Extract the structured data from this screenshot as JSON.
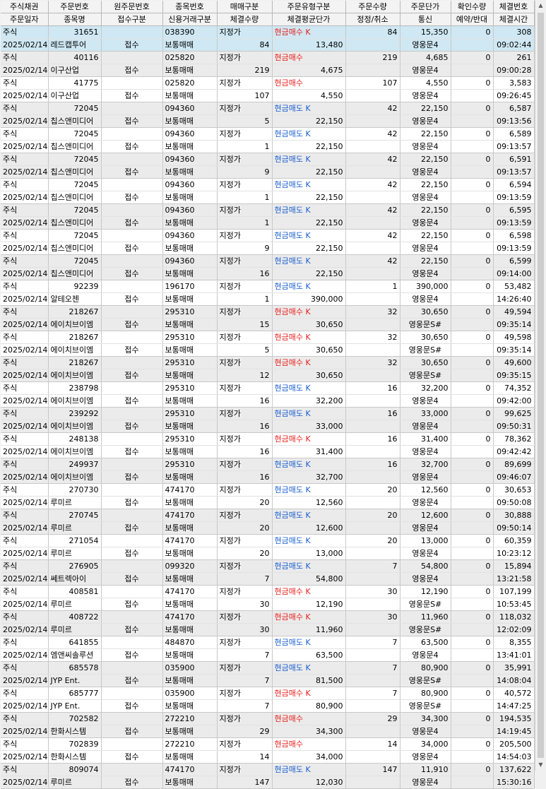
{
  "header": {
    "row1": [
      "주식채권",
      "주문번호",
      "원주문번호",
      "종목번호",
      "매매구분",
      "주문유형구분",
      "주문수량",
      "주문단가",
      "확인수량",
      "체결번호"
    ],
    "row2": [
      "주문일자",
      "종목명",
      "접수구분",
      "신용거래구분",
      "체결수량",
      "체결평균단가",
      "정정/취소",
      "통신",
      "예약/반대",
      "체결시간"
    ]
  },
  "colors": {
    "buy": "#e8201c",
    "sell": "#1a5fd0",
    "selected_row": "#cfe8f3",
    "alt_row": "#ebebeb"
  },
  "rows": [
    {
      "market": "주식",
      "order_no": "31651",
      "orig_order_no": "",
      "stock_code": "038390",
      "trade_type": "지정가",
      "order_type": "현금매수 K",
      "side": "buy",
      "order_qty": "84",
      "order_price": "15,350",
      "confirm_qty": "0",
      "exec_no": "308",
      "date": "2025/02/14",
      "stock_name": "레드캡투어",
      "receipt": "접수",
      "credit_type": "보통매매",
      "exec_qty": "84",
      "avg_price": "13,480",
      "modify_cancel": "",
      "comm": "영웅문4",
      "reserve": "",
      "exec_time": "09:02:44",
      "selected": true
    },
    {
      "market": "주식",
      "order_no": "40116",
      "orig_order_no": "",
      "stock_code": "025820",
      "trade_type": "지정가",
      "order_type": "현금매수",
      "side": "buy",
      "order_qty": "219",
      "order_price": "4,685",
      "confirm_qty": "0",
      "exec_no": "261",
      "date": "2025/02/14",
      "stock_name": "이구산업",
      "receipt": "접수",
      "credit_type": "보통매매",
      "exec_qty": "219",
      "avg_price": "4,675",
      "modify_cancel": "",
      "comm": "영웅문4",
      "reserve": "",
      "exec_time": "09:00:28"
    },
    {
      "market": "주식",
      "order_no": "41775",
      "orig_order_no": "",
      "stock_code": "025820",
      "trade_type": "지정가",
      "order_type": "현금매수",
      "side": "buy",
      "order_qty": "107",
      "order_price": "4,550",
      "confirm_qty": "0",
      "exec_no": "3,583",
      "date": "2025/02/14",
      "stock_name": "이구산업",
      "receipt": "접수",
      "credit_type": "보통매매",
      "exec_qty": "107",
      "avg_price": "4,550",
      "modify_cancel": "",
      "comm": "영웅문4",
      "reserve": "",
      "exec_time": "09:26:45"
    },
    {
      "market": "주식",
      "order_no": "72045",
      "orig_order_no": "",
      "stock_code": "094360",
      "trade_type": "지정가",
      "order_type": "현금매도 K",
      "side": "sell",
      "order_qty": "42",
      "order_price": "22,150",
      "confirm_qty": "0",
      "exec_no": "6,587",
      "date": "2025/02/14",
      "stock_name": "칩스앤미디어",
      "receipt": "접수",
      "credit_type": "보통매매",
      "exec_qty": "5",
      "avg_price": "22,150",
      "modify_cancel": "",
      "comm": "영웅문4",
      "reserve": "",
      "exec_time": "09:13:56"
    },
    {
      "market": "주식",
      "order_no": "72045",
      "orig_order_no": "",
      "stock_code": "094360",
      "trade_type": "지정가",
      "order_type": "현금매도 K",
      "side": "sell",
      "order_qty": "42",
      "order_price": "22,150",
      "confirm_qty": "0",
      "exec_no": "6,589",
      "date": "2025/02/14",
      "stock_name": "칩스앤미디어",
      "receipt": "접수",
      "credit_type": "보통매매",
      "exec_qty": "1",
      "avg_price": "22,150",
      "modify_cancel": "",
      "comm": "영웅문4",
      "reserve": "",
      "exec_time": "09:13:57"
    },
    {
      "market": "주식",
      "order_no": "72045",
      "orig_order_no": "",
      "stock_code": "094360",
      "trade_type": "지정가",
      "order_type": "현금매도 K",
      "side": "sell",
      "order_qty": "42",
      "order_price": "22,150",
      "confirm_qty": "0",
      "exec_no": "6,591",
      "date": "2025/02/14",
      "stock_name": "칩스앤미디어",
      "receipt": "접수",
      "credit_type": "보통매매",
      "exec_qty": "9",
      "avg_price": "22,150",
      "modify_cancel": "",
      "comm": "영웅문4",
      "reserve": "",
      "exec_time": "09:13:57"
    },
    {
      "market": "주식",
      "order_no": "72045",
      "orig_order_no": "",
      "stock_code": "094360",
      "trade_type": "지정가",
      "order_type": "현금매도 K",
      "side": "sell",
      "order_qty": "42",
      "order_price": "22,150",
      "confirm_qty": "0",
      "exec_no": "6,594",
      "date": "2025/02/14",
      "stock_name": "칩스앤미디어",
      "receipt": "접수",
      "credit_type": "보통매매",
      "exec_qty": "1",
      "avg_price": "22,150",
      "modify_cancel": "",
      "comm": "영웅문4",
      "reserve": "",
      "exec_time": "09:13:59"
    },
    {
      "market": "주식",
      "order_no": "72045",
      "orig_order_no": "",
      "stock_code": "094360",
      "trade_type": "지정가",
      "order_type": "현금매도 K",
      "side": "sell",
      "order_qty": "42",
      "order_price": "22,150",
      "confirm_qty": "0",
      "exec_no": "6,595",
      "date": "2025/02/14",
      "stock_name": "칩스앤미디어",
      "receipt": "접수",
      "credit_type": "보통매매",
      "exec_qty": "1",
      "avg_price": "22,150",
      "modify_cancel": "",
      "comm": "영웅문4",
      "reserve": "",
      "exec_time": "09:13:59"
    },
    {
      "market": "주식",
      "order_no": "72045",
      "orig_order_no": "",
      "stock_code": "094360",
      "trade_type": "지정가",
      "order_type": "현금매도 K",
      "side": "sell",
      "order_qty": "42",
      "order_price": "22,150",
      "confirm_qty": "0",
      "exec_no": "6,598",
      "date": "2025/02/14",
      "stock_name": "칩스앤미디어",
      "receipt": "접수",
      "credit_type": "보통매매",
      "exec_qty": "9",
      "avg_price": "22,150",
      "modify_cancel": "",
      "comm": "영웅문4",
      "reserve": "",
      "exec_time": "09:13:59"
    },
    {
      "market": "주식",
      "order_no": "72045",
      "orig_order_no": "",
      "stock_code": "094360",
      "trade_type": "지정가",
      "order_type": "현금매도 K",
      "side": "sell",
      "order_qty": "42",
      "order_price": "22,150",
      "confirm_qty": "0",
      "exec_no": "6,599",
      "date": "2025/02/14",
      "stock_name": "칩스앤미디어",
      "receipt": "접수",
      "credit_type": "보통매매",
      "exec_qty": "16",
      "avg_price": "22,150",
      "modify_cancel": "",
      "comm": "영웅문4",
      "reserve": "",
      "exec_time": "09:14:00"
    },
    {
      "market": "주식",
      "order_no": "92239",
      "orig_order_no": "",
      "stock_code": "196170",
      "trade_type": "지정가",
      "order_type": "현금매도 K",
      "side": "sell",
      "order_qty": "1",
      "order_price": "390,000",
      "confirm_qty": "0",
      "exec_no": "53,482",
      "date": "2025/02/14",
      "stock_name": "알테오젠",
      "receipt": "접수",
      "credit_type": "보통매매",
      "exec_qty": "1",
      "avg_price": "390,000",
      "modify_cancel": "",
      "comm": "영웅문4",
      "reserve": "",
      "exec_time": "14:26:40"
    },
    {
      "market": "주식",
      "order_no": "218267",
      "orig_order_no": "",
      "stock_code": "295310",
      "trade_type": "지정가",
      "order_type": "현금매수 K",
      "side": "buy",
      "order_qty": "32",
      "order_price": "30,650",
      "confirm_qty": "0",
      "exec_no": "49,594",
      "date": "2025/02/14",
      "stock_name": "에이치브이엠",
      "receipt": "접수",
      "credit_type": "보통매매",
      "exec_qty": "15",
      "avg_price": "30,650",
      "modify_cancel": "",
      "comm": "영웅문S#",
      "reserve": "",
      "exec_time": "09:35:14"
    },
    {
      "market": "주식",
      "order_no": "218267",
      "orig_order_no": "",
      "stock_code": "295310",
      "trade_type": "지정가",
      "order_type": "현금매수 K",
      "side": "buy",
      "order_qty": "32",
      "order_price": "30,650",
      "confirm_qty": "0",
      "exec_no": "49,598",
      "date": "2025/02/14",
      "stock_name": "에이치브이엠",
      "receipt": "접수",
      "credit_type": "보통매매",
      "exec_qty": "5",
      "avg_price": "30,650",
      "modify_cancel": "",
      "comm": "영웅문S#",
      "reserve": "",
      "exec_time": "09:35:14"
    },
    {
      "market": "주식",
      "order_no": "218267",
      "orig_order_no": "",
      "stock_code": "295310",
      "trade_type": "지정가",
      "order_type": "현금매수 K",
      "side": "buy",
      "order_qty": "32",
      "order_price": "30,650",
      "confirm_qty": "0",
      "exec_no": "49,600",
      "date": "2025/02/14",
      "stock_name": "에이치브이엠",
      "receipt": "접수",
      "credit_type": "보통매매",
      "exec_qty": "12",
      "avg_price": "30,650",
      "modify_cancel": "",
      "comm": "영웅문S#",
      "reserve": "",
      "exec_time": "09:35:15"
    },
    {
      "market": "주식",
      "order_no": "238798",
      "orig_order_no": "",
      "stock_code": "295310",
      "trade_type": "지정가",
      "order_type": "현금매도 K",
      "side": "sell",
      "order_qty": "16",
      "order_price": "32,200",
      "confirm_qty": "0",
      "exec_no": "74,352",
      "date": "2025/02/14",
      "stock_name": "에이치브이엠",
      "receipt": "접수",
      "credit_type": "보통매매",
      "exec_qty": "16",
      "avg_price": "32,200",
      "modify_cancel": "",
      "comm": "영웅문4",
      "reserve": "",
      "exec_time": "09:42:00"
    },
    {
      "market": "주식",
      "order_no": "239292",
      "orig_order_no": "",
      "stock_code": "295310",
      "trade_type": "지정가",
      "order_type": "현금매도 K",
      "side": "sell",
      "order_qty": "16",
      "order_price": "33,000",
      "confirm_qty": "0",
      "exec_no": "99,625",
      "date": "2025/02/14",
      "stock_name": "에이치브이엠",
      "receipt": "접수",
      "credit_type": "보통매매",
      "exec_qty": "16",
      "avg_price": "33,000",
      "modify_cancel": "",
      "comm": "영웅문4",
      "reserve": "",
      "exec_time": "09:50:31"
    },
    {
      "market": "주식",
      "order_no": "248138",
      "orig_order_no": "",
      "stock_code": "295310",
      "trade_type": "지정가",
      "order_type": "현금매수 K",
      "side": "buy",
      "order_qty": "16",
      "order_price": "31,400",
      "confirm_qty": "0",
      "exec_no": "78,362",
      "date": "2025/02/14",
      "stock_name": "에이치브이엠",
      "receipt": "접수",
      "credit_type": "보통매매",
      "exec_qty": "16",
      "avg_price": "31,400",
      "modify_cancel": "",
      "comm": "영웅문4",
      "reserve": "",
      "exec_time": "09:42:42"
    },
    {
      "market": "주식",
      "order_no": "249937",
      "orig_order_no": "",
      "stock_code": "295310",
      "trade_type": "지정가",
      "order_type": "현금매도 K",
      "side": "sell",
      "order_qty": "16",
      "order_price": "32,700",
      "confirm_qty": "0",
      "exec_no": "89,699",
      "date": "2025/02/14",
      "stock_name": "에이치브이엠",
      "receipt": "접수",
      "credit_type": "보통매매",
      "exec_qty": "16",
      "avg_price": "32,700",
      "modify_cancel": "",
      "comm": "영웅문4",
      "reserve": "",
      "exec_time": "09:46:07"
    },
    {
      "market": "주식",
      "order_no": "270730",
      "orig_order_no": "",
      "stock_code": "474170",
      "trade_type": "지정가",
      "order_type": "현금매도 K",
      "side": "sell",
      "order_qty": "20",
      "order_price": "12,560",
      "confirm_qty": "0",
      "exec_no": "30,653",
      "date": "2025/02/14",
      "stock_name": "루미르",
      "receipt": "접수",
      "credit_type": "보통매매",
      "exec_qty": "20",
      "avg_price": "12,560",
      "modify_cancel": "",
      "comm": "영웅문4",
      "reserve": "",
      "exec_time": "09:50:08"
    },
    {
      "market": "주식",
      "order_no": "270745",
      "orig_order_no": "",
      "stock_code": "474170",
      "trade_type": "지정가",
      "order_type": "현금매도 K",
      "side": "sell",
      "order_qty": "20",
      "order_price": "12,600",
      "confirm_qty": "0",
      "exec_no": "30,888",
      "date": "2025/02/14",
      "stock_name": "루미르",
      "receipt": "접수",
      "credit_type": "보통매매",
      "exec_qty": "20",
      "avg_price": "12,600",
      "modify_cancel": "",
      "comm": "영웅문4",
      "reserve": "",
      "exec_time": "09:50:14"
    },
    {
      "market": "주식",
      "order_no": "271054",
      "orig_order_no": "",
      "stock_code": "474170",
      "trade_type": "지정가",
      "order_type": "현금매도 K",
      "side": "sell",
      "order_qty": "20",
      "order_price": "13,000",
      "confirm_qty": "0",
      "exec_no": "60,359",
      "date": "2025/02/14",
      "stock_name": "루미르",
      "receipt": "접수",
      "credit_type": "보통매매",
      "exec_qty": "20",
      "avg_price": "13,000",
      "modify_cancel": "",
      "comm": "영웅문4",
      "reserve": "",
      "exec_time": "10:23:12"
    },
    {
      "market": "주식",
      "order_no": "276905",
      "orig_order_no": "",
      "stock_code": "099320",
      "trade_type": "지정가",
      "order_type": "현금매도 K",
      "side": "sell",
      "order_qty": "7",
      "order_price": "54,800",
      "confirm_qty": "0",
      "exec_no": "15,894",
      "date": "2025/02/14",
      "stock_name": "쎄트렉아이",
      "receipt": "접수",
      "credit_type": "보통매매",
      "exec_qty": "7",
      "avg_price": "54,800",
      "modify_cancel": "",
      "comm": "영웅문4",
      "reserve": "",
      "exec_time": "13:21:58"
    },
    {
      "market": "주식",
      "order_no": "408581",
      "orig_order_no": "",
      "stock_code": "474170",
      "trade_type": "지정가",
      "order_type": "현금매수 K",
      "side": "buy",
      "order_qty": "30",
      "order_price": "12,190",
      "confirm_qty": "0",
      "exec_no": "107,199",
      "date": "2025/02/14",
      "stock_name": "루미르",
      "receipt": "접수",
      "credit_type": "보통매매",
      "exec_qty": "30",
      "avg_price": "12,190",
      "modify_cancel": "",
      "comm": "영웅문S#",
      "reserve": "",
      "exec_time": "10:53:45"
    },
    {
      "market": "주식",
      "order_no": "408722",
      "orig_order_no": "",
      "stock_code": "474170",
      "trade_type": "지정가",
      "order_type": "현금매수 K",
      "side": "buy",
      "order_qty": "30",
      "order_price": "11,960",
      "confirm_qty": "0",
      "exec_no": "118,032",
      "date": "2025/02/14",
      "stock_name": "루미르",
      "receipt": "접수",
      "credit_type": "보통매매",
      "exec_qty": "30",
      "avg_price": "11,960",
      "modify_cancel": "",
      "comm": "영웅문S#",
      "reserve": "",
      "exec_time": "12:02:09"
    },
    {
      "market": "주식",
      "order_no": "641855",
      "orig_order_no": "",
      "stock_code": "484870",
      "trade_type": "지정가",
      "order_type": "현금매도 K",
      "side": "sell",
      "order_qty": "7",
      "order_price": "63,500",
      "confirm_qty": "0",
      "exec_no": "8,355",
      "date": "2025/02/14",
      "stock_name": "엠앤씨솔루션",
      "receipt": "접수",
      "credit_type": "보통매매",
      "exec_qty": "7",
      "avg_price": "63,500",
      "modify_cancel": "",
      "comm": "영웅문4",
      "reserve": "",
      "exec_time": "13:41:01"
    },
    {
      "market": "주식",
      "order_no": "685578",
      "orig_order_no": "",
      "stock_code": "035900",
      "trade_type": "지정가",
      "order_type": "현금매도 K",
      "side": "sell",
      "order_qty": "7",
      "order_price": "80,900",
      "confirm_qty": "0",
      "exec_no": "35,991",
      "date": "2025/02/14",
      "stock_name": "JYP Ent.",
      "receipt": "접수",
      "credit_type": "보통매매",
      "exec_qty": "7",
      "avg_price": "81,500",
      "modify_cancel": "",
      "comm": "영웅문S#",
      "reserve": "",
      "exec_time": "14:08:04"
    },
    {
      "market": "주식",
      "order_no": "685777",
      "orig_order_no": "",
      "stock_code": "035900",
      "trade_type": "지정가",
      "order_type": "현금매수 K",
      "side": "buy",
      "order_qty": "7",
      "order_price": "80,900",
      "confirm_qty": "0",
      "exec_no": "40,572",
      "date": "2025/02/14",
      "stock_name": "JYP Ent.",
      "receipt": "접수",
      "credit_type": "보통매매",
      "exec_qty": "7",
      "avg_price": "80,900",
      "modify_cancel": "",
      "comm": "영웅문S#",
      "reserve": "",
      "exec_time": "14:47:25"
    },
    {
      "market": "주식",
      "order_no": "702582",
      "orig_order_no": "",
      "stock_code": "272210",
      "trade_type": "지정가",
      "order_type": "현금매수",
      "side": "buy",
      "order_qty": "29",
      "order_price": "34,300",
      "confirm_qty": "0",
      "exec_no": "194,535",
      "date": "2025/02/14",
      "stock_name": "한화시스템",
      "receipt": "접수",
      "credit_type": "보통매매",
      "exec_qty": "29",
      "avg_price": "34,300",
      "modify_cancel": "",
      "comm": "영웅문4",
      "reserve": "",
      "exec_time": "14:19:45"
    },
    {
      "market": "주식",
      "order_no": "702839",
      "orig_order_no": "",
      "stock_code": "272210",
      "trade_type": "지정가",
      "order_type": "현금매수",
      "side": "buy",
      "order_qty": "14",
      "order_price": "34,000",
      "confirm_qty": "0",
      "exec_no": "205,500",
      "date": "2025/02/14",
      "stock_name": "한화시스템",
      "receipt": "접수",
      "credit_type": "보통매매",
      "exec_qty": "14",
      "avg_price": "34,000",
      "modify_cancel": "",
      "comm": "영웅문4",
      "reserve": "",
      "exec_time": "14:54:03"
    },
    {
      "market": "주식",
      "order_no": "809074",
      "orig_order_no": "",
      "stock_code": "474170",
      "trade_type": "지정가",
      "order_type": "현금매도 K",
      "side": "sell",
      "order_qty": "147",
      "order_price": "11,910",
      "confirm_qty": "0",
      "exec_no": "137,622",
      "date": "2025/02/14",
      "stock_name": "루미르",
      "receipt": "접수",
      "credit_type": "보통매매",
      "exec_qty": "147",
      "avg_price": "12,030",
      "modify_cancel": "",
      "comm": "영웅문4",
      "reserve": "",
      "exec_time": "15:30:16"
    }
  ]
}
